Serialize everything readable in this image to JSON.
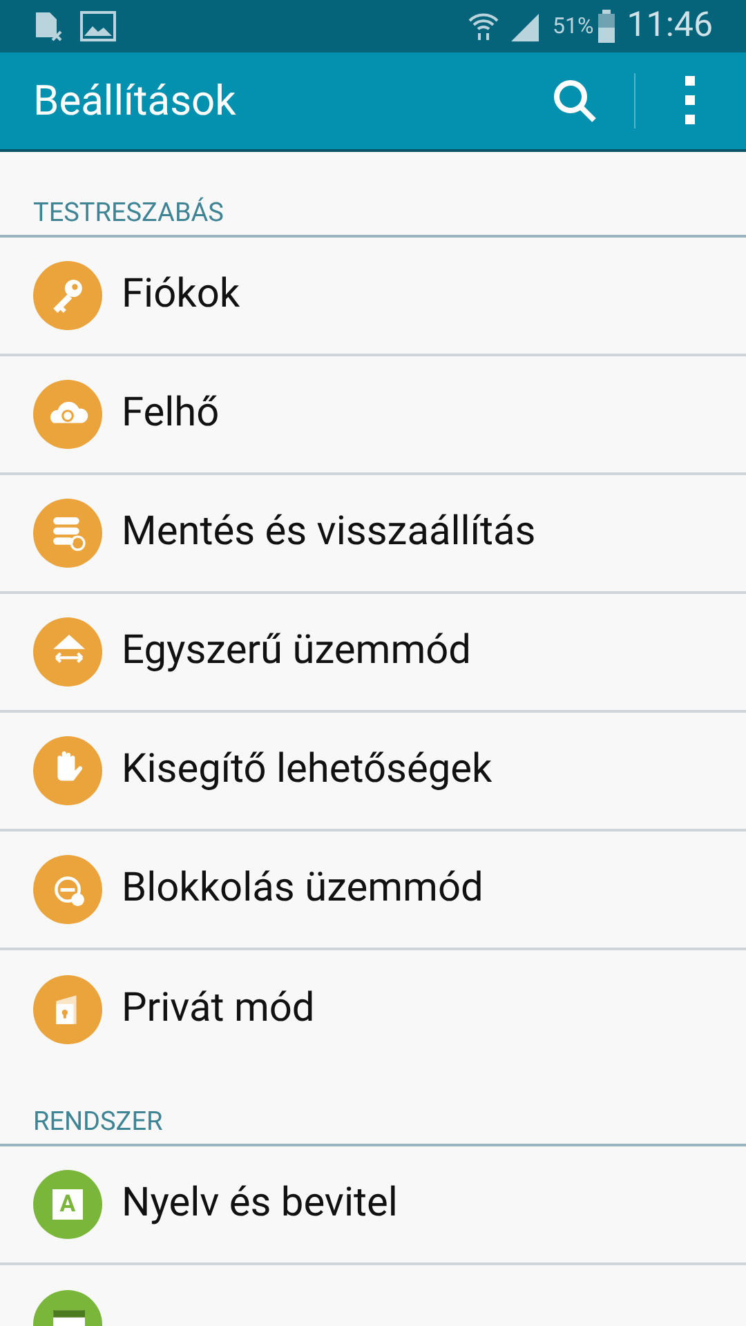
{
  "status_bar": {
    "battery": "51%",
    "time": "11:46"
  },
  "app_bar": {
    "title": "Beállítások"
  },
  "sections": [
    {
      "title": "TESTRESZABÁS",
      "items": [
        {
          "label": "Fiókok",
          "kind": "key",
          "color": "#eba33b"
        },
        {
          "label": "Felhő",
          "kind": "cloud",
          "color": "#eba33b"
        },
        {
          "label": "Mentés és visszaállítás",
          "kind": "backup",
          "color": "#eba33b"
        },
        {
          "label": "Egyszerű üzemmód",
          "kind": "home",
          "color": "#eba33b"
        },
        {
          "label": "Kisegítő lehetőségek",
          "kind": "hand",
          "color": "#eba33b"
        },
        {
          "label": "Blokkolás üzemmód",
          "kind": "block",
          "color": "#eba33b"
        },
        {
          "label": "Privát mód",
          "kind": "private",
          "color": "#eba33b"
        }
      ]
    },
    {
      "title": "RENDSZER",
      "items": [
        {
          "label": "Nyelv és bevitel",
          "kind": "letter",
          "icon_text": "A",
          "color": "#7ab63a"
        },
        {
          "kind": "calendar",
          "color": "#7ab63a"
        }
      ]
    }
  ]
}
